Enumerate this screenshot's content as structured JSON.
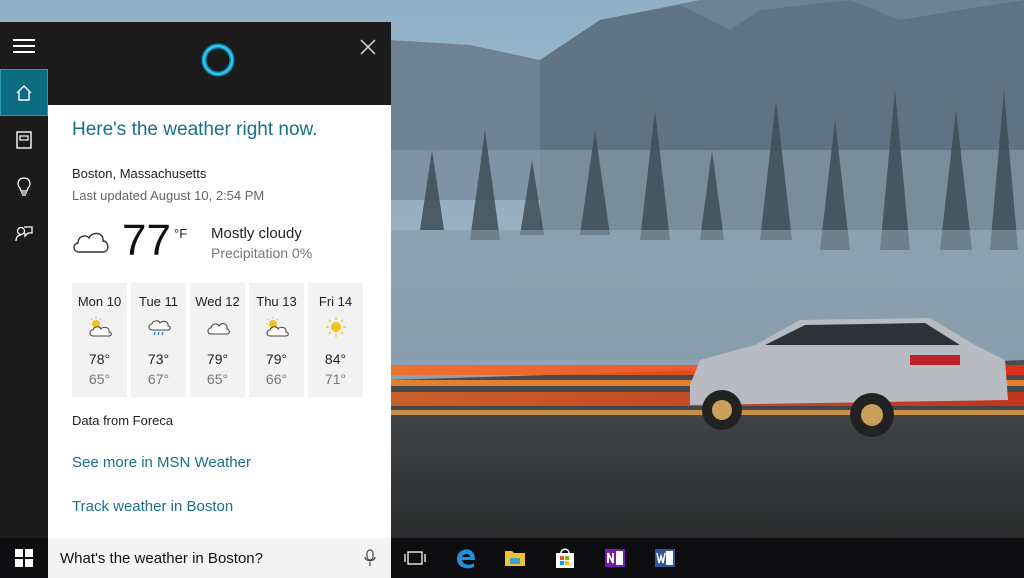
{
  "cortana": {
    "headline": "Here's the weather right now.",
    "location": "Boston, Massachusetts",
    "last_updated": "Last updated August 10, 2:54 PM",
    "current": {
      "temp": "77",
      "unit": "°F",
      "condition": "Mostly cloudy",
      "precipitation": "Precipitation 0%",
      "icon": "cloudy-icon"
    },
    "forecast": [
      {
        "day": "Mon 10",
        "high": "78°",
        "low": "65°",
        "icon": "partly-sunny-icon"
      },
      {
        "day": "Tue 11",
        "high": "73°",
        "low": "67°",
        "icon": "rain-icon"
      },
      {
        "day": "Wed 12",
        "high": "79°",
        "low": "65°",
        "icon": "cloudy-icon"
      },
      {
        "day": "Thu 13",
        "high": "79°",
        "low": "66°",
        "icon": "partly-sunny-icon"
      },
      {
        "day": "Fri 14",
        "high": "84°",
        "low": "71°",
        "icon": "sunny-icon"
      }
    ],
    "source": "Data from Foreca",
    "link_msn": "See more in MSN Weather",
    "link_track": "Track weather in Boston"
  },
  "taskbar": {
    "search_value": "What's the weather in Boston?",
    "apps": [
      "task-view-icon",
      "edge-icon",
      "file-explorer-icon",
      "store-icon",
      "onenote-icon",
      "word-icon"
    ]
  },
  "colors": {
    "accent": "#1a6e8c",
    "rail": "#1b1b1b",
    "taskbar": "#0d0d0f"
  }
}
